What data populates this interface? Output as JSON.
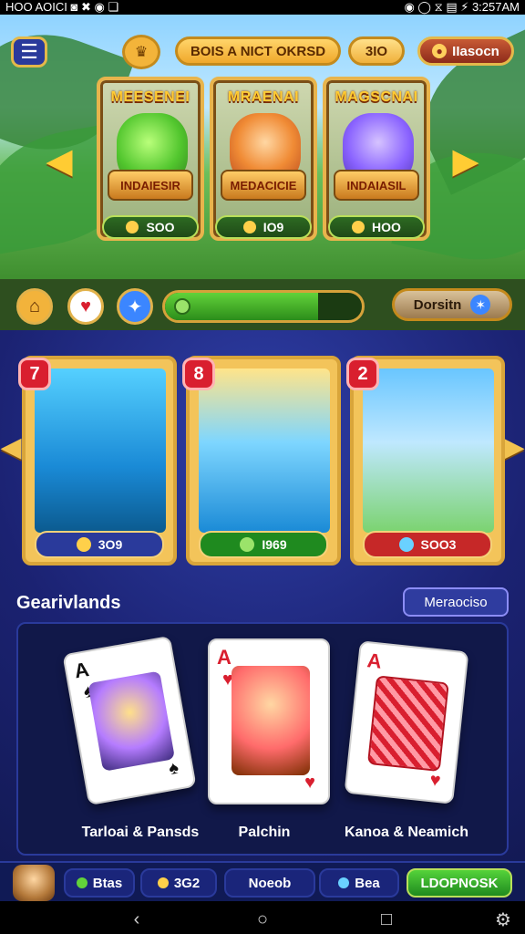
{
  "statusbar": {
    "left": "HOO AOICI ◙ ✖ ◉ ❏",
    "right": "◉ ◯ ⧖ ▤ ⚡ 3:257AM"
  },
  "topbar": {
    "center_pill": "BOIS A NICT OKRSD",
    "small_pill": "3IO",
    "right_pill": "IIasocn"
  },
  "hero": {
    "cards": [
      {
        "title": "MEESENEI",
        "ribbon": "INDAIESIR",
        "price": "SOO"
      },
      {
        "title": "MRAENAI",
        "ribbon": "MEDACICIE",
        "price": "IO9"
      },
      {
        "title": "MAGSCNAI",
        "ribbon": "INDAIASIL",
        "price": "HOO"
      }
    ]
  },
  "actions": {
    "right_pill": "Dorsitn",
    "progress_fraction": 0.78
  },
  "games": {
    "cards": [
      {
        "badge": "7",
        "label": "3O9"
      },
      {
        "badge": "8",
        "label": "I969"
      },
      {
        "badge": "2",
        "label": "SOO3"
      }
    ]
  },
  "section": {
    "title": "Gearivlands",
    "button": "Meraociso"
  },
  "playing_cards": [
    {
      "caption": "Tarloai & Pansds"
    },
    {
      "caption": "Palchin"
    },
    {
      "caption": "Kanoa & Neamich"
    }
  ],
  "bottombar": {
    "seg1": "Btas",
    "seg2": "3G2",
    "seg3": "Noeob",
    "seg4": "Bea",
    "cta": "LDOPNOSK"
  },
  "colors": {
    "gold": "#e4b84a",
    "green": "#2c8d1a",
    "blue": "#1b2272",
    "red": "#d91f2f"
  }
}
